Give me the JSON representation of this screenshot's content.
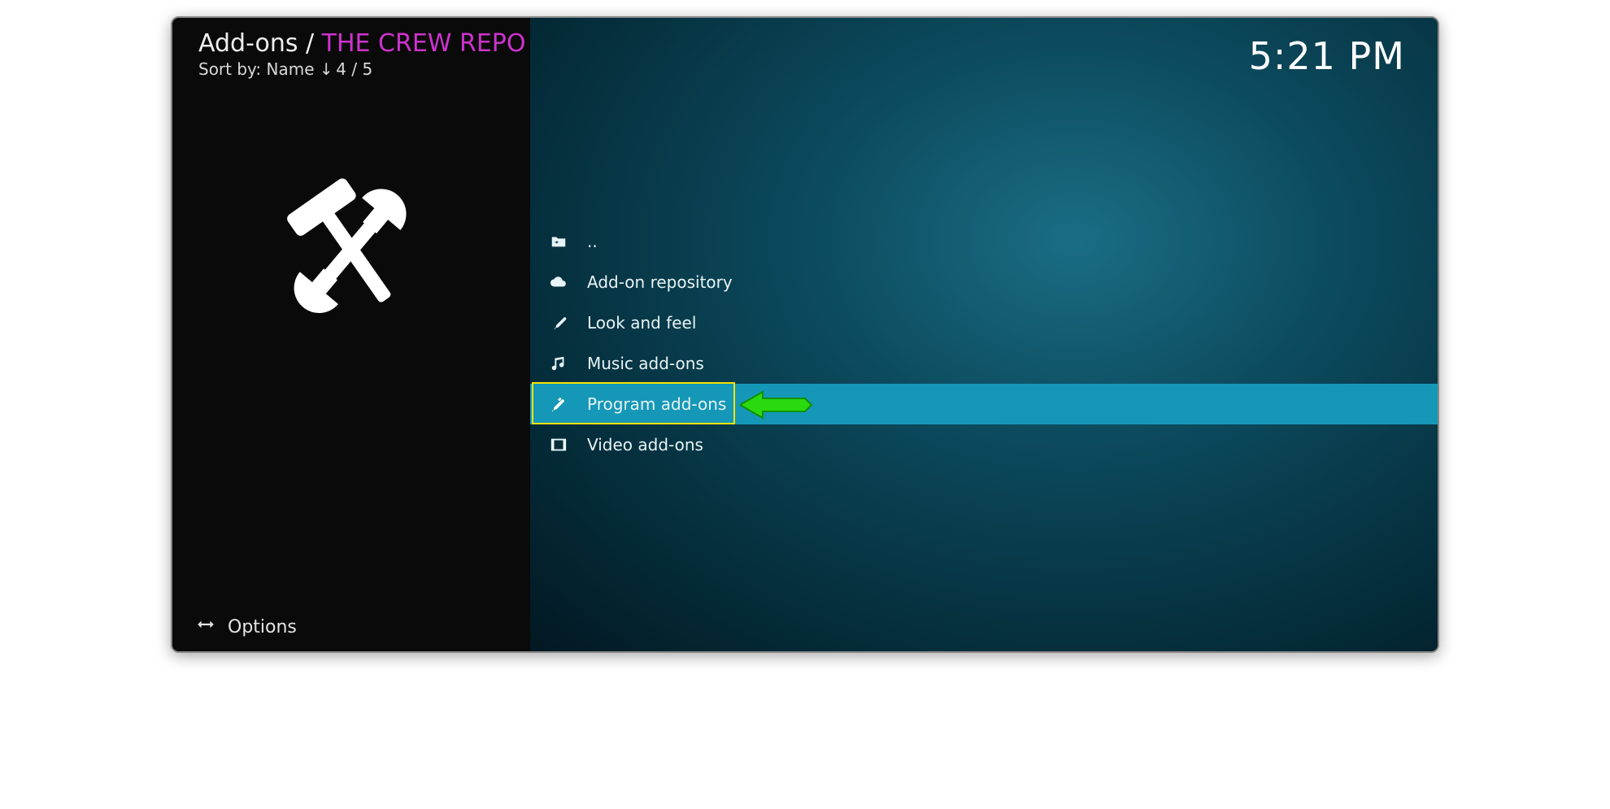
{
  "header": {
    "breadcrumb_root": "Add-ons",
    "breadcrumb_sep": " / ",
    "breadcrumb_current": "THE CREW REPO",
    "sort_prefix": "Sort by: ",
    "sort_field": "Name",
    "position": "4 / 5"
  },
  "clock": "5:21 PM",
  "list": {
    "items": [
      {
        "icon": "folder-back-icon",
        "label": ".."
      },
      {
        "icon": "cloud-icon",
        "label": "Add-on repository"
      },
      {
        "icon": "paint-icon",
        "label": "Look and feel"
      },
      {
        "icon": "music-icon",
        "label": "Music add-ons"
      },
      {
        "icon": "tools-icon",
        "label": "Program add-ons",
        "selected": true
      },
      {
        "icon": "video-icon",
        "label": "Video add-ons"
      }
    ]
  },
  "footer": {
    "options_label": "Options"
  }
}
